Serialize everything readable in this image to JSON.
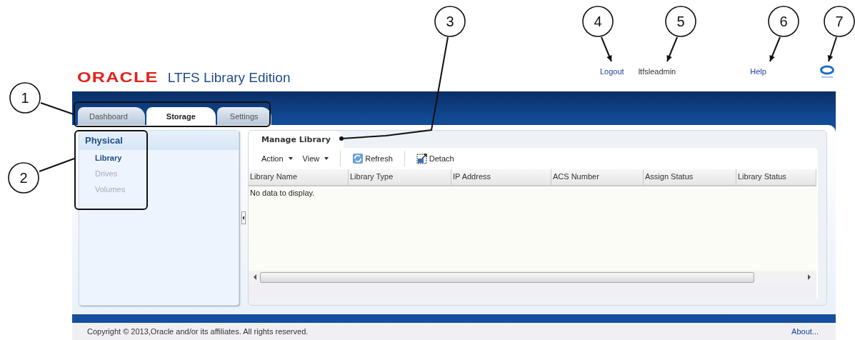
{
  "header": {
    "logo": "ORACLE",
    "product": "LTFS Library Edition",
    "links": [
      {
        "kind": "link",
        "label": "Logout"
      },
      {
        "kind": "user",
        "label": "ltfsleadmin"
      },
      {
        "kind": "link",
        "label": "Help"
      }
    ]
  },
  "tabs": [
    {
      "label": "Dashboard",
      "selected": false
    },
    {
      "label": "Storage",
      "selected": true
    },
    {
      "label": "Settings",
      "selected": false
    }
  ],
  "sidebar": {
    "heading": "Physical",
    "items": [
      {
        "label": "Library",
        "selected": true
      },
      {
        "label": "Drives",
        "selected": false
      },
      {
        "label": "Volumes",
        "selected": false
      }
    ]
  },
  "panel": {
    "title": "Manage Library",
    "toolbar": [
      {
        "kind": "menu",
        "label": "Action"
      },
      {
        "kind": "menu",
        "label": "View"
      },
      {
        "kind": "refresh",
        "label": "Refresh"
      },
      {
        "kind": "detach",
        "label": "Detach"
      }
    ],
    "table": {
      "columns": [
        "Library Name",
        "Library Type",
        "IP Address",
        "ACS Number",
        "Assign Status",
        "Library Status"
      ],
      "empty_message": "No data to display."
    }
  },
  "footer": {
    "copyright": "Copyright © 2013,Oracle and/or its affiliates. All rights reserved.",
    "about": "About..."
  },
  "callouts": [
    {
      "label": "1"
    },
    {
      "label": "2"
    },
    {
      "label": "3"
    },
    {
      "label": "4"
    },
    {
      "label": "5"
    },
    {
      "label": "6"
    },
    {
      "label": "7"
    }
  ]
}
